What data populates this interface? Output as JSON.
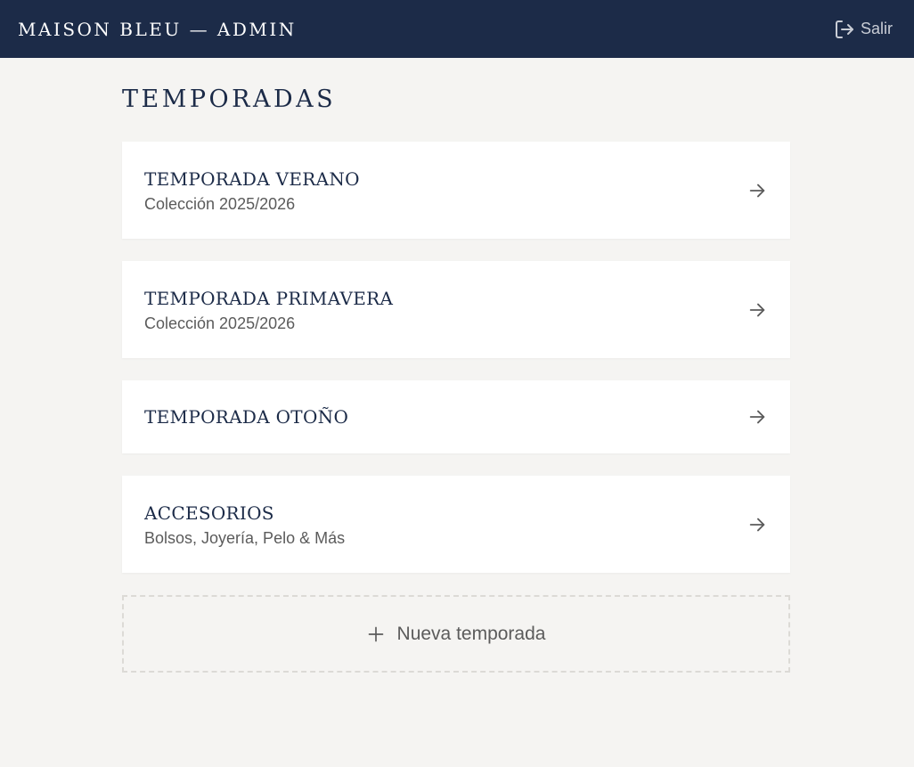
{
  "header": {
    "brand": "MAISON BLEU — ADMIN",
    "logout_label": "Salir",
    "logout_icon": "logout-icon"
  },
  "page": {
    "title": "TEMPORADAS"
  },
  "seasons": [
    {
      "title": "TEMPORADA VERANO",
      "subtitle": "Colección 2025/2026"
    },
    {
      "title": "TEMPORADA PRIMAVERA",
      "subtitle": "Colección 2025/2026"
    },
    {
      "title": "TEMPORADA OTOÑO",
      "subtitle": ""
    },
    {
      "title": "ACCESORIOS",
      "subtitle": "Bolsos, Joyería, Pelo & Más"
    }
  ],
  "new_season": {
    "label": "Nueva temporada",
    "icon": "plus-icon"
  },
  "colors": {
    "header_bg": "#1c2b48",
    "page_bg": "#f5f4f2",
    "card_bg": "#ffffff",
    "title_text": "#1c2b48",
    "muted_text": "#5b5b5b"
  }
}
